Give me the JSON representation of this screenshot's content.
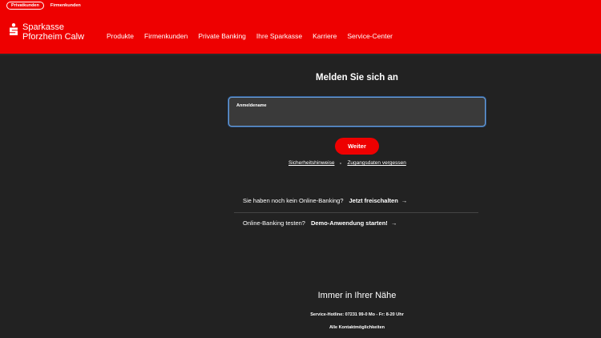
{
  "header": {
    "segments": [
      "Privatkunden",
      "Firmenkunden"
    ],
    "brand_line1": "Sparkasse",
    "brand_line2": "Pforzheim Calw",
    "nav": [
      "Produkte",
      "Firmenkunden",
      "Private Banking",
      "Ihre Sparkasse",
      "Karriere",
      "Service-Center"
    ],
    "brand_color": "#ee0000"
  },
  "login": {
    "title": "Melden Sie sich an",
    "username_label": "Anmeldename",
    "username_value": "",
    "submit_label": "Weiter",
    "link_security": "Sicherheitshinweise",
    "link_forgot": "Zugangsdaten vergessen"
  },
  "rows": [
    {
      "question": "Sie haben noch kein Online-Banking?",
      "action": "Jetzt freischalten",
      "icon": "arrow-right-icon"
    },
    {
      "question": "Online-Banking testen?",
      "action": "Demo-Anwendung starten!",
      "icon": "arrow-right-icon"
    }
  ],
  "footer": {
    "title": "Immer in Ihrer Nähe",
    "hotline": "Service-Hotline: 07231 99-0 Mo - Fr: 8-20 Uhr",
    "contact_link": "Alle Kontaktmöglichkeiten"
  }
}
